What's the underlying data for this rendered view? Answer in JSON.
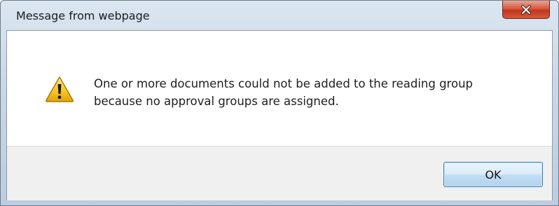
{
  "dialog": {
    "title": "Message from webpage",
    "close_icon": "close-icon",
    "warning_icon": "warning-icon",
    "message": "One or more documents could not be added to the reading group\nbecause no approval groups are assigned.",
    "ok_label": "OK"
  },
  "colors": {
    "titlebar": "#c9d8e8",
    "close_button": "#c9422a",
    "footer": "#f0f0f0",
    "ok_border": "#3c7fb1",
    "warning_fill": "#f6c521"
  }
}
